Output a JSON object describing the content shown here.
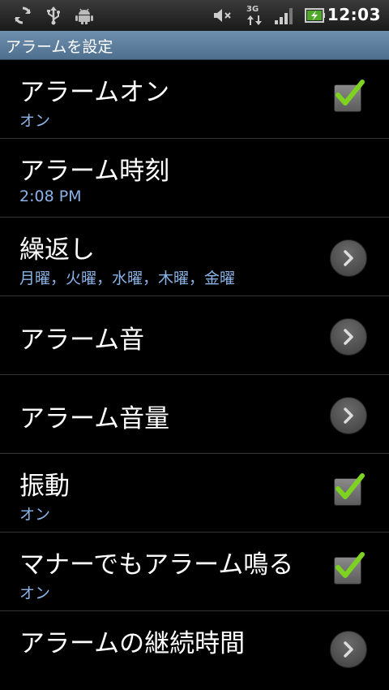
{
  "status_bar": {
    "time": "12:03",
    "network_label": "3G",
    "icons": [
      "sync-icon",
      "usb-icon",
      "android-debug-icon",
      "mute-icon",
      "network-3g-icon",
      "signal-icon",
      "battery-charging-icon"
    ]
  },
  "title_bar": {
    "title": "アラームを設定"
  },
  "colors": {
    "title_bar": "#5f7f9f",
    "subtitle": "#8ab4e8",
    "check": "#7ed321"
  },
  "rows": [
    {
      "title": "アラームオン",
      "subtitle": "オン",
      "control": "checkbox",
      "checked": true
    },
    {
      "title": "アラーム時刻",
      "subtitle": "2:08 PM",
      "control": "none"
    },
    {
      "title": "繰返し",
      "subtitle": "月曜，火曜，水曜，木曜，金曜",
      "control": "chevron"
    },
    {
      "title": "アラーム音",
      "control": "chevron"
    },
    {
      "title": "アラーム音量",
      "control": "chevron"
    },
    {
      "title": "振動",
      "subtitle": "オン",
      "control": "checkbox",
      "checked": true
    },
    {
      "title": "マナーでもアラーム鳴る",
      "subtitle": "オン",
      "control": "checkbox",
      "checked": true
    },
    {
      "title": "アラームの継続時間",
      "control": "chevron"
    }
  ]
}
